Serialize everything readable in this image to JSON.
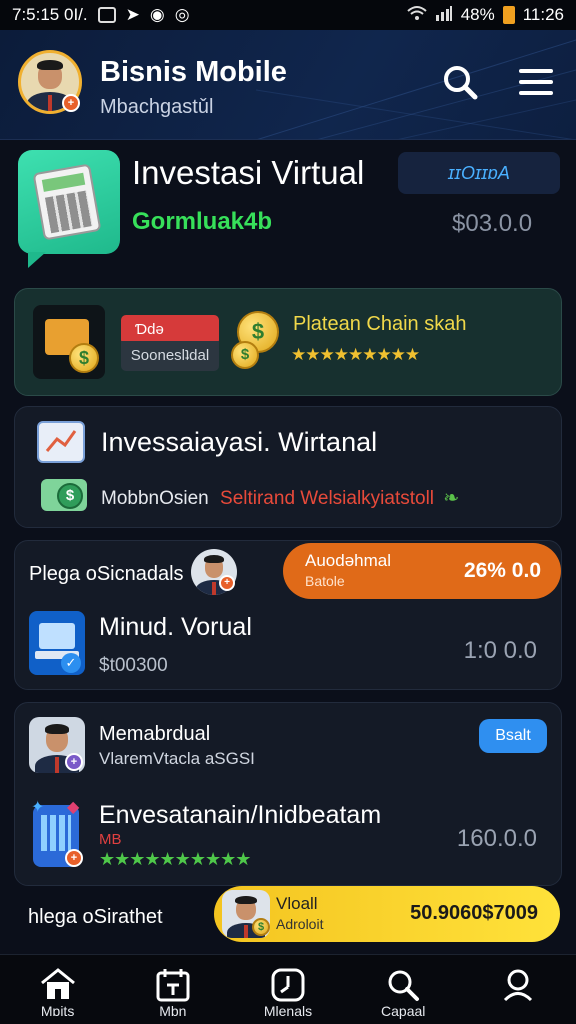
{
  "status": {
    "time_left": "7:5:15 0I/.",
    "battery": "48%",
    "clock": "11:26"
  },
  "header": {
    "title": "Bisnis Mobile",
    "subtitle": "Mbachgastǔl"
  },
  "hero": {
    "title": "Investasi Virtual",
    "subtitle": "Gormluak4b",
    "pill": "ɪɪOɪɪɒA",
    "amount": "$03.0.0"
  },
  "promo": {
    "red_label": "Ɗdǝ",
    "grey_label": "Sooneslʇdal",
    "title": "Platean Chain skah",
    "stars": "★★★★★★★★★"
  },
  "invest": {
    "title": "Invessaiayasi. Wirtanal",
    "line_white": "MobbnOsien",
    "line_red": "Seltirand Welsialkyiatstoll"
  },
  "section3": {
    "label": "Plega oSicnadals",
    "pill_title": "Auodǝhmal",
    "pill_sub": "Batole",
    "pill_value": "26% 0.0",
    "item_title": "Minud. Vorual",
    "item_sub": "$t00300",
    "item_amount": "1:0 0.0"
  },
  "section4": {
    "name": "Memabrdual",
    "sub": "VlaremVtacla aSGSI",
    "pill": "Bsalt",
    "item_title": "Envesatanain/Inidbeatam",
    "item_tag": "MB",
    "stars": "★★★★★★★★★★",
    "item_amount": "160.0.0"
  },
  "bottom": {
    "label": "hlega oSirathet",
    "pill_title": "Vloall",
    "pill_sub": "Adroloit",
    "pill_value": "50.9060$7009"
  },
  "nav": [
    {
      "label": "Mɒits"
    },
    {
      "label": "Mbn"
    },
    {
      "label": "Mlenals"
    },
    {
      "label": "Capaal"
    }
  ]
}
